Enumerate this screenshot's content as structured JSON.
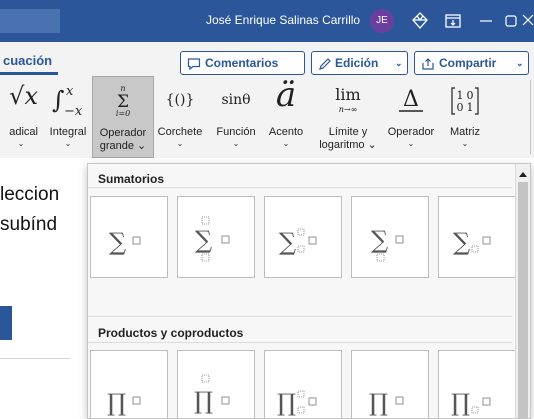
{
  "titlebar": {
    "user_name": "José Enrique Salinas Carrillo",
    "avatar_initials": "JE",
    "bg_color": "#2b579a",
    "icons": [
      "diamond-icon",
      "ribbon-display-icon",
      "minimize-icon",
      "restore-icon",
      "close-icon"
    ]
  },
  "tabs": {
    "active_label": "cuación",
    "comments_label": "Comentarios",
    "editing_label": "Edición",
    "share_label": "Compartir"
  },
  "ribbon": {
    "buttons": [
      {
        "label": "adical",
        "symbol": "√x"
      },
      {
        "label": "Integral",
        "symbol": "∫"
      },
      {
        "label": "Operador",
        "label2": "grande",
        "symbol": "Σ",
        "selected": true
      },
      {
        "label": "Corchete",
        "symbol": "{()}"
      },
      {
        "label": "Función",
        "symbol": "sinθ"
      },
      {
        "label": "Acento",
        "symbol": "ä"
      },
      {
        "label": "Límite y",
        "label2": "logaritmo",
        "symbol": "lim"
      },
      {
        "label": "Operador",
        "symbol": "Δ"
      },
      {
        "label": "Matriz",
        "symbol": "[10;01]"
      }
    ],
    "limit_sub": "n→∞"
  },
  "document": {
    "line1": "leccion",
    "line2": "subínd"
  },
  "gallery": {
    "section1_title": "Sumatorios",
    "section2_title": "Productos y coproductos",
    "section1_items": [
      "sum",
      "sum-upper-lower",
      "sum-sub-sup",
      "sum-lower",
      "sum-sub"
    ],
    "section2_items": [
      "product",
      "product-upper-lower",
      "product-sub-sup",
      "product-lower",
      "product-sub"
    ]
  }
}
